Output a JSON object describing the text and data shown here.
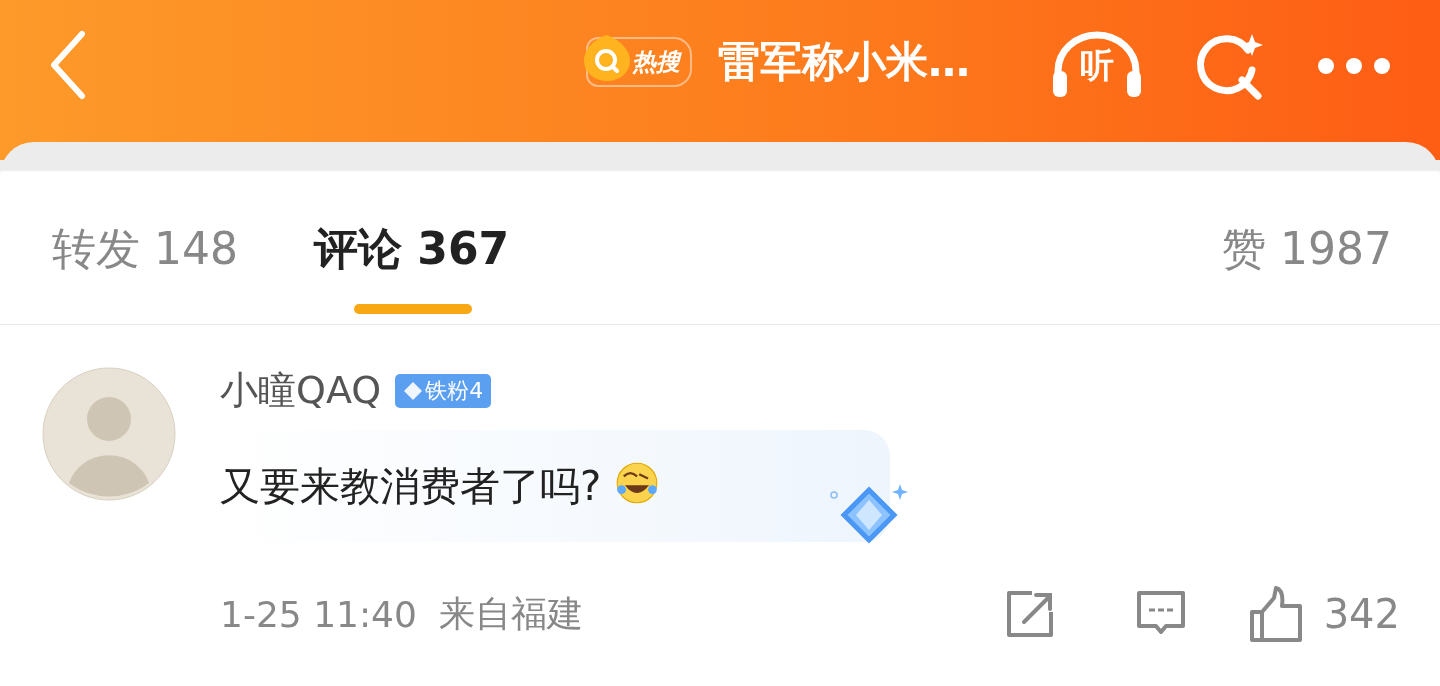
{
  "header": {
    "hot_badge": "热搜",
    "title": "雷军称小米…",
    "listen_label": "听"
  },
  "tabs": [
    {
      "label": "转发 148",
      "selected": false
    },
    {
      "label": "评论 367",
      "selected": true
    },
    {
      "label": "赞 1987",
      "selected": false
    }
  ],
  "comment": {
    "user": "小瞳QAQ",
    "fan_badge": "铁粉4",
    "text": "又要来教消费者了吗?",
    "time": "1-25 11:40",
    "location": "来自福建",
    "likes": "342"
  }
}
